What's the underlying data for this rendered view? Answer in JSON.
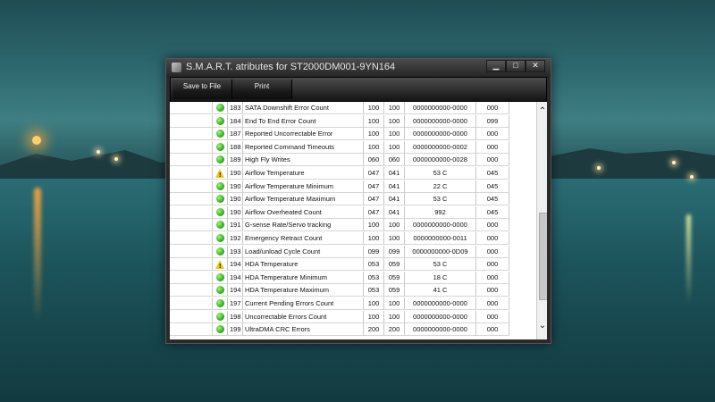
{
  "window": {
    "title": "S.M.A.R.T. atributes for ST2000DM001-9YN164",
    "minimize": "▁",
    "maximize": "□",
    "close": "✕"
  },
  "toolbar": {
    "save_label": "Save to File",
    "print_label": "Print"
  },
  "attributes": [
    {
      "status": "ok",
      "id": "183",
      "name": "SATA Downshift Error Count",
      "value": "100",
      "worst": "100",
      "raw": "0000000000-0000",
      "threshold": "000"
    },
    {
      "status": "ok",
      "id": "184",
      "name": "End To End Error Count",
      "value": "100",
      "worst": "100",
      "raw": "0000000000-0000",
      "threshold": "099"
    },
    {
      "status": "ok",
      "id": "187",
      "name": "Reported Uncorrectable Error",
      "value": "100",
      "worst": "100",
      "raw": "0000000000-0000",
      "threshold": "000"
    },
    {
      "status": "ok",
      "id": "188",
      "name": "Reported Command Timeouts",
      "value": "100",
      "worst": "100",
      "raw": "0000000000-0002",
      "threshold": "000"
    },
    {
      "status": "ok",
      "id": "189",
      "name": "High Fly Writes",
      "value": "060",
      "worst": "060",
      "raw": "0000000000-0028",
      "threshold": "000"
    },
    {
      "status": "warn",
      "id": "190",
      "name": "Airflow Temperature",
      "value": "047",
      "worst": "041",
      "raw": "53 C",
      "threshold": "045"
    },
    {
      "status": "ok",
      "id": "190",
      "name": "Airflow Temperature Minimum",
      "value": "047",
      "worst": "041",
      "raw": "22 C",
      "threshold": "045"
    },
    {
      "status": "ok",
      "id": "190",
      "name": "Airflow Temperature Maximum",
      "value": "047",
      "worst": "041",
      "raw": "53 C",
      "threshold": "045"
    },
    {
      "status": "ok",
      "id": "190",
      "name": "Airflow Overheated Count",
      "value": "047",
      "worst": "041",
      "raw": "992",
      "threshold": "045"
    },
    {
      "status": "ok",
      "id": "191",
      "name": "G-sense Rate/Servo tracking",
      "value": "100",
      "worst": "100",
      "raw": "0000000000-0000",
      "threshold": "000"
    },
    {
      "status": "ok",
      "id": "192",
      "name": "Emergency Retract Count",
      "value": "100",
      "worst": "100",
      "raw": "0000000000-0011",
      "threshold": "000"
    },
    {
      "status": "ok",
      "id": "193",
      "name": "Load/unload Cycle Count",
      "value": "099",
      "worst": "099",
      "raw": "0000000000-0D09",
      "threshold": "000"
    },
    {
      "status": "warn",
      "id": "194",
      "name": "HDA Temperature",
      "value": "053",
      "worst": "059",
      "raw": "53 C",
      "threshold": "000"
    },
    {
      "status": "ok",
      "id": "194",
      "name": "HDA Temperature Minimum",
      "value": "053",
      "worst": "059",
      "raw": "18 C",
      "threshold": "000"
    },
    {
      "status": "ok",
      "id": "194",
      "name": "HDA Temperature Maximum",
      "value": "053",
      "worst": "059",
      "raw": "41 C",
      "threshold": "000"
    },
    {
      "status": "ok",
      "id": "197",
      "name": "Current Pending Errors Count",
      "value": "100",
      "worst": "100",
      "raw": "0000000000-0000",
      "threshold": "000"
    },
    {
      "status": "ok",
      "id": "198",
      "name": "Uncorrectable Errors Count",
      "value": "100",
      "worst": "100",
      "raw": "0000000000-0000",
      "threshold": "000"
    },
    {
      "status": "ok",
      "id": "199",
      "name": "UltraDMA CRC Errors",
      "value": "200",
      "worst": "200",
      "raw": "0000000000-0000",
      "threshold": "000"
    }
  ],
  "scrollbar": {
    "up_icon": "⌃",
    "down_icon": "⌄"
  },
  "colors": {
    "status_ok": "#2fb521",
    "status_warn": "#f0c419"
  }
}
